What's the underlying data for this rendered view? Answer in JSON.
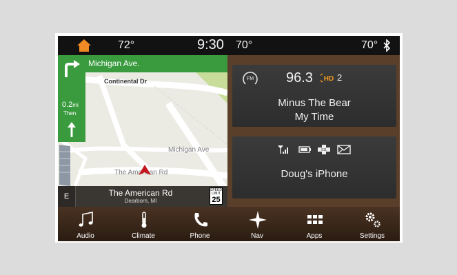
{
  "status": {
    "home_icon": "home-icon",
    "temp_left": "72°",
    "time": "9:30",
    "temp_mid": "70°",
    "temp_right": "70°",
    "bluetooth_icon": "bluetooth-icon"
  },
  "nav": {
    "next_street": "Michigan Ave.",
    "distance": "0.2",
    "distance_unit": "mi",
    "then_label": "Then",
    "labels": {
      "continental": "Continental Dr",
      "michigan": "Michigan Ave",
      "american": "The American Rd"
    },
    "compass": "E",
    "current_road": "The American Rd",
    "current_city": "Dearborn, MI",
    "speed_limit_label": "SPEED LIMIT",
    "speed_limit": "25"
  },
  "radio": {
    "band_icon": "fm-icon",
    "band_label": "FM",
    "frequency": "96.3",
    "hd_channel": "2",
    "artist": "Minus The Bear",
    "song": "My Time"
  },
  "phone": {
    "device_name": "Doug's iPhone",
    "status_icons": [
      "signal-icon",
      "battery-icon",
      "sos-icon",
      "mail-icon"
    ]
  },
  "dock": {
    "items": [
      {
        "label": "Audio",
        "icon": "music-note-icon"
      },
      {
        "label": "Climate",
        "icon": "thermometer-icon"
      },
      {
        "label": "Phone",
        "icon": "phone-icon"
      },
      {
        "label": "Nav",
        "icon": "compass-star-icon"
      },
      {
        "label": "Apps",
        "icon": "apps-grid-icon"
      },
      {
        "label": "Settings",
        "icon": "gears-icon"
      }
    ]
  },
  "colors": {
    "nav_green": "#3a9b3e",
    "home_orange": "#f08a24",
    "hd_orange": "#f29a1d",
    "car_red": "#c4161c"
  }
}
